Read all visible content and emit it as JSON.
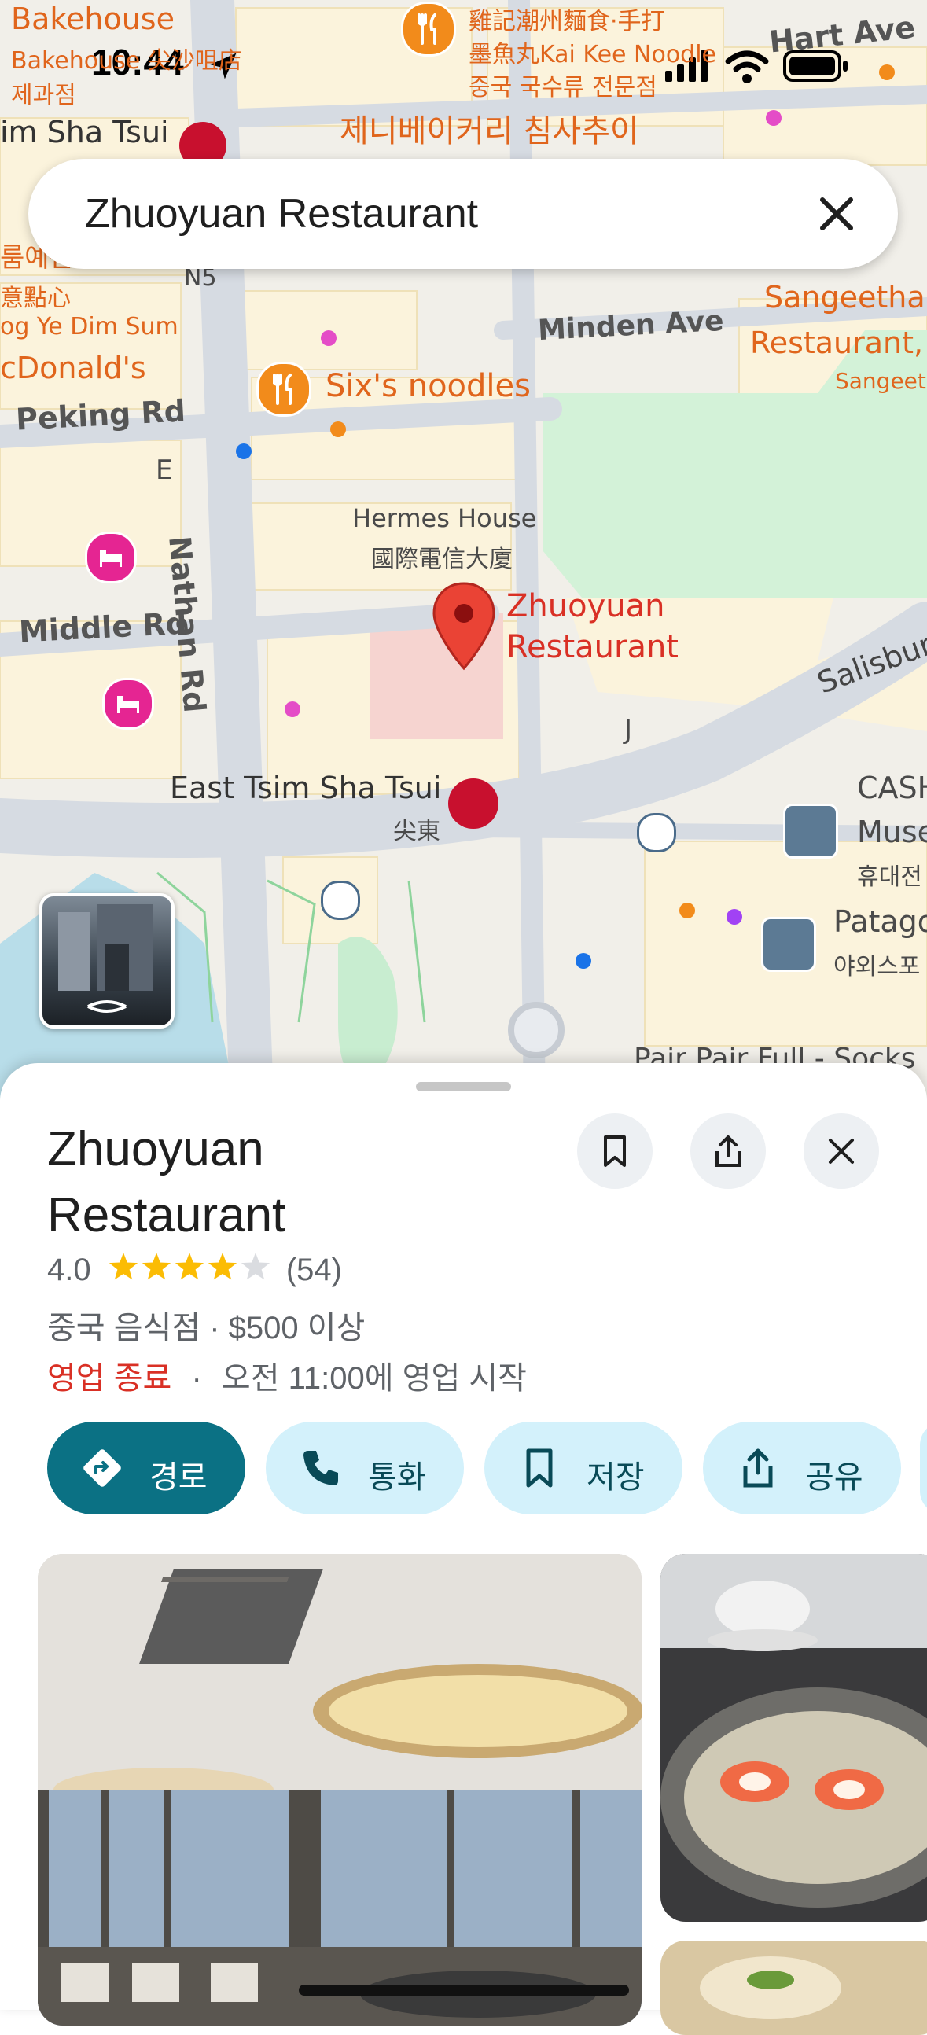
{
  "status_bar": {
    "time": "10:44"
  },
  "search": {
    "query": "Zhuoyuan Restaurant"
  },
  "map": {
    "labels": {
      "bakehouse": "Bakehouse",
      "bakehouse_sub": "Bakehouse 尖沙咀店",
      "bakehouse_kr": "제과점",
      "kai_kee_1": "雞記潮州麵食·手打",
      "kai_kee_2": "墨魚丸Kai Kee Noodle",
      "kai_kee_kr": "중국 국수류 전문점",
      "hart_ave": "Hart Ave",
      "tst_station": "im Sha Tsui",
      "bakery_kr": "제니베이커리 침사추이",
      "n5": "N5",
      "ye_dim_1": "룸예관",
      "ye_dim_2": "意點心",
      "ye_dim_3": "og Ye Dim Sum",
      "mcdonalds": "cDonald's",
      "minden_ave": "Minden Ave",
      "sangeetha_1": "Sangeetha",
      "sangeetha_2": "Restaurant,",
      "sangeetha_3": "Sangeet",
      "sixs_noodles": "Six's noodles",
      "peking_rd": "Peking Rd",
      "exit_e": "E",
      "hermes_1": "Hermes House",
      "hermes_2": "國際電信大廈",
      "nathan_rd": "Nathan Rd",
      "zhuoyuan_1": "Zhuoyuan",
      "zhuoyuan_2": "Restaurant",
      "middle_rd": "Middle Rd",
      "salisbury": "Salisbury",
      "exit_j": "J",
      "east_tst": "East Tsim Sha Tsui",
      "east_tst_zh": "尖東",
      "cash_1": "CASH",
      "cash_2": "Muse",
      "cash_3": "휴대전",
      "patagonia_1": "Patago",
      "patagonia_2": "야외스포",
      "pair_pair": "Pair Pair Full - Socks"
    }
  },
  "place": {
    "title_line1": "Zhuoyuan",
    "title_line2": "Restaurant",
    "rating": "4.0",
    "stars": 4,
    "review_count": "(54)",
    "category": "중국 음식점 · $500 이상",
    "status_closed": "영업 종료",
    "hours_sep": "·",
    "hours_detail": "오전 11:00에 영업 시작",
    "actions": {
      "directions": "경로",
      "call": "통화",
      "save": "저장",
      "share": "공유"
    }
  },
  "colors": {
    "accent": "#0b7184",
    "accent_light": "#d3f1fb",
    "closed_red": "#d93025",
    "star": "#fbbc04",
    "pin": "#ea4335"
  }
}
